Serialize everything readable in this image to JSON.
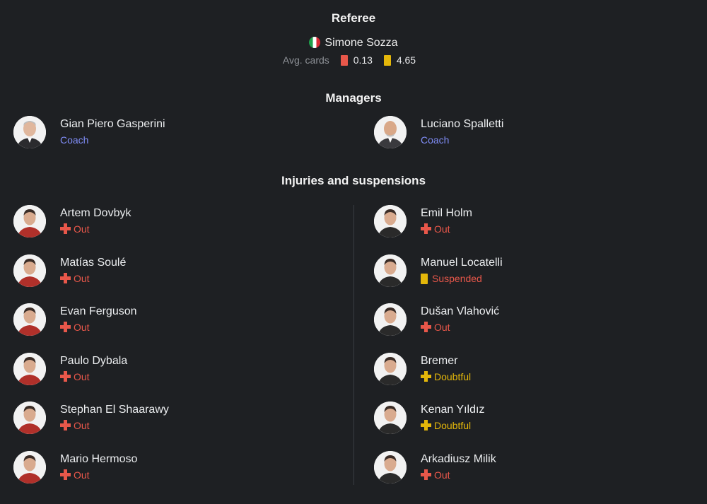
{
  "referee": {
    "title": "Referee",
    "name": "Simone Sozza",
    "flag_icon": "italy-flag-icon",
    "avg_cards_label": "Avg. cards",
    "red_avg": "0.13",
    "yellow_avg": "4.65"
  },
  "managers": {
    "title": "Managers",
    "home": {
      "name": "Gian Piero Gasperini",
      "role": "Coach"
    },
    "away": {
      "name": "Luciano Spalletti",
      "role": "Coach"
    }
  },
  "injuries": {
    "title": "Injuries and suspensions",
    "home": [
      {
        "name": "Artem Dovbyk",
        "status": "Out",
        "type": "out"
      },
      {
        "name": "Matías Soulé",
        "status": "Out",
        "type": "out"
      },
      {
        "name": "Evan Ferguson",
        "status": "Out",
        "type": "out"
      },
      {
        "name": "Paulo Dybala",
        "status": "Out",
        "type": "out"
      },
      {
        "name": "Stephan El Shaarawy",
        "status": "Out",
        "type": "out"
      },
      {
        "name": "Mario Hermoso",
        "status": "Out",
        "type": "out"
      }
    ],
    "away": [
      {
        "name": "Emil Holm",
        "status": "Out",
        "type": "out"
      },
      {
        "name": "Manuel Locatelli",
        "status": "Suspended",
        "type": "suspended"
      },
      {
        "name": "Dušan Vlahović",
        "status": "Out",
        "type": "out"
      },
      {
        "name": "Bremer",
        "status": "Doubtful",
        "type": "doubtful"
      },
      {
        "name": "Kenan Yıldız",
        "status": "Doubtful",
        "type": "doubtful"
      },
      {
        "name": "Arkadiusz Milik",
        "status": "Out",
        "type": "out"
      }
    ]
  },
  "colors": {
    "background": "#1e2023",
    "out": "#e8574a",
    "doubtful": "#e4b70a",
    "role": "#7f8cf5",
    "home_kit": "#b0302a",
    "away_kit": "#2a2a2a"
  }
}
